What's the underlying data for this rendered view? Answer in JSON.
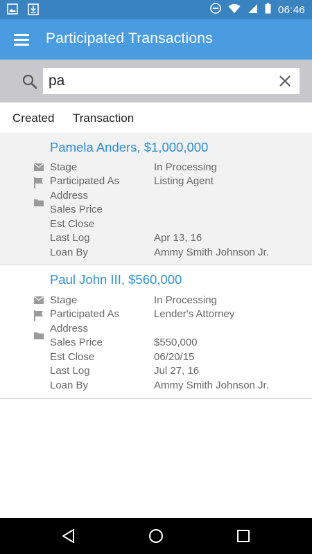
{
  "status_bar": {
    "time": "06:46",
    "left_icons": [
      "image-icon",
      "download-icon"
    ],
    "right_icons": [
      "do-not-disturb-icon",
      "wifi-icon",
      "signal-icon",
      "battery-icon"
    ]
  },
  "app_bar": {
    "title": "Participated Transactions",
    "menu_icon": "hamburger-menu-icon"
  },
  "search": {
    "value": "pa",
    "icon": "search-icon",
    "clear_icon": "close-icon"
  },
  "sort": {
    "items": [
      "Created",
      "Transaction"
    ]
  },
  "transactions": [
    {
      "title": "Pamela Anders, $1,000,000",
      "selected": true,
      "labels": [
        "Stage",
        "Participated As",
        "Address",
        "Sales Price",
        "Est Close",
        "Last Log",
        "Loan By"
      ],
      "values": [
        "In Processing",
        "Listing Agent",
        "",
        "",
        "",
        "Apr 13, 16",
        "Ammy Smith Johnson Jr."
      ]
    },
    {
      "title": "Paul John III, $560,000",
      "selected": false,
      "labels": [
        "Stage",
        "Participated As",
        "Address",
        "Sales Price",
        "Est Close",
        "Last Log",
        "Loan By"
      ],
      "values": [
        "In Processing",
        "Lender's Attorney",
        "",
        "$550,000",
        "06/20/15",
        "Jul 27, 16",
        "Ammy Smith Johnson Jr."
      ]
    }
  ],
  "card_icons": [
    "mail-icon",
    "flag-icon",
    "folder-icon"
  ],
  "nav_bar": {
    "buttons": [
      "back-icon",
      "home-icon",
      "recents-icon"
    ]
  },
  "colors": {
    "status_bar": "#3a83c1",
    "app_bar": "#4a9ce0",
    "title_link": "#2c8fd6",
    "search_area": "#c8c8cc",
    "selected_card": "#f2f2f2"
  }
}
